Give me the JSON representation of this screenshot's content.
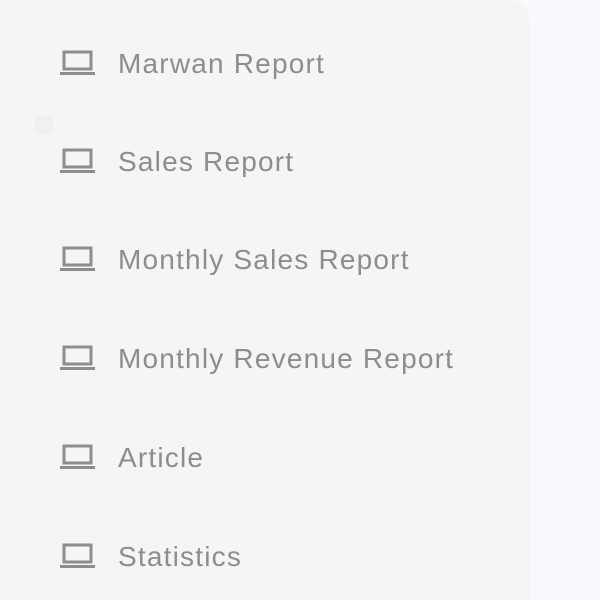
{
  "menu": {
    "items": [
      {
        "label": "Marwan Report",
        "icon": "laptop-icon"
      },
      {
        "label": "Sales Report",
        "icon": "laptop-icon"
      },
      {
        "label": "Monthly Sales Report",
        "icon": "laptop-icon"
      },
      {
        "label": "Monthly Revenue Report",
        "icon": "laptop-icon"
      },
      {
        "label": "Article",
        "icon": "laptop-icon"
      },
      {
        "label": "Statistics",
        "icon": "laptop-icon"
      }
    ]
  },
  "colors": {
    "panel": "#f5f5f6",
    "text": "#8d8d8f",
    "icon": "#8d8d8f",
    "background": "#f8f9fc"
  }
}
